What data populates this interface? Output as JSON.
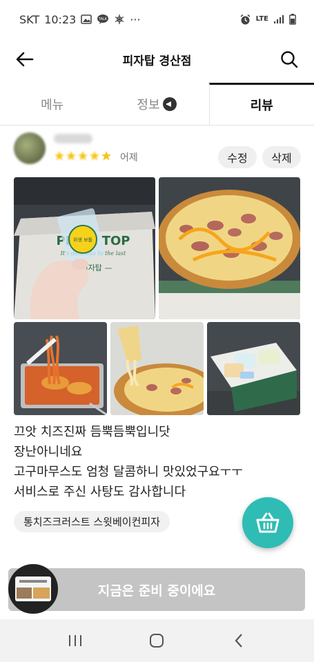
{
  "status": {
    "carrier": "SKT",
    "time": "10:23",
    "more": "···",
    "network": "LTE"
  },
  "header": {
    "title": "피자탑 경산점"
  },
  "tabs": [
    {
      "label": "메뉴",
      "active": false
    },
    {
      "label": "정보",
      "active": false
    },
    {
      "label": "리뷰",
      "active": true
    }
  ],
  "review": {
    "date": "어제",
    "rating": 5,
    "edit_label": "수정",
    "delete_label": "삭제",
    "photo_text": {
      "sticker": "위생 보틀",
      "box_brand": "PIZZA TOP",
      "box_slogan": "It's delicious to the last"
    },
    "text_lines": [
      "끄앗 치즈진짜 듬뿍듬뿍입니닷",
      "장난아니네요",
      "고구마무스도 엄청 달콤하니 맛있었구요ㅜㅜ",
      "서비스로 주신 사탕도 감사합니다"
    ],
    "menu_tag": "통치즈크러스트 스윗베이컨피자"
  },
  "order": {
    "label": "지금은 준비 중이에요"
  },
  "colors": {
    "accent": "#2fbcb4",
    "disabled": "#c4c4c4",
    "star": "#f5c518"
  }
}
